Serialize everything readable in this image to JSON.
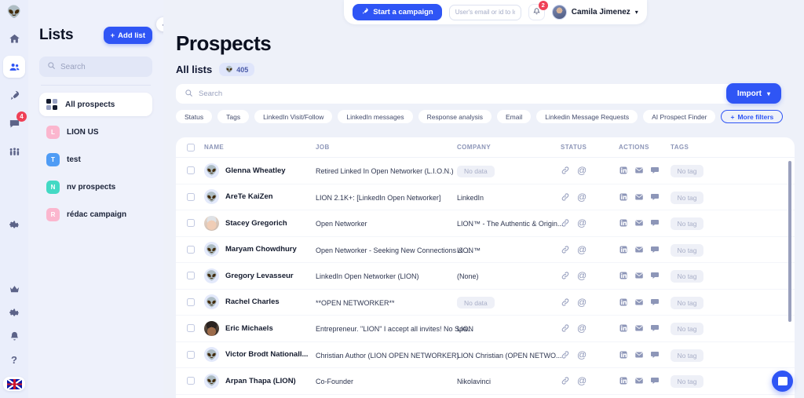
{
  "brand": {
    "logo_icon": "alien-logo",
    "accent": "#2f55f5",
    "danger": "#ef4056"
  },
  "rail": {
    "items": [
      {
        "name": "home",
        "icon": "home-icon",
        "badge": ""
      },
      {
        "name": "prospects",
        "icon": "people-icon",
        "badge": "",
        "active": true
      },
      {
        "name": "campaigns",
        "icon": "rocket-icon",
        "badge": ""
      },
      {
        "name": "inbox",
        "icon": "chat-icon",
        "badge": "4"
      },
      {
        "name": "teams",
        "icon": "group-icon",
        "badge": ""
      },
      {
        "name": "settings",
        "icon": "gear-icon",
        "badge": ""
      }
    ],
    "bottom": [
      {
        "name": "upgrade",
        "icon": "crown-icon"
      },
      {
        "name": "preferences",
        "icon": "gear-icon"
      },
      {
        "name": "notifications",
        "icon": "bell-icon"
      },
      {
        "name": "help",
        "icon": "question-icon"
      },
      {
        "name": "language",
        "icon": "uk-flag-icon"
      }
    ]
  },
  "sidebar": {
    "title": "Lists",
    "add_list_label": "Add list",
    "add_icon": "plus-icon",
    "search": {
      "placeholder": "Search",
      "value": "",
      "icon": "search-icon"
    },
    "all_prospects": {
      "label": "All prospects",
      "icon": "grid-icon"
    },
    "lists": [
      {
        "initial": "L",
        "label": "LION US",
        "color": "#fbb6ce"
      },
      {
        "initial": "T",
        "label": "test",
        "color": "#4f9cf5"
      },
      {
        "initial": "N",
        "label": "nv prospects",
        "color": "#43d9c4"
      },
      {
        "initial": "R",
        "label": "rédac campaign",
        "color": "#fbb6ce"
      }
    ],
    "collapse_icon": "chevron-left-icon"
  },
  "topbar": {
    "campaign_button": {
      "label": "Start a campaign",
      "icon": "rocket-icon"
    },
    "login_input": {
      "placeholder": "User's email or id to login",
      "value": ""
    },
    "bell": {
      "icon": "bell-icon",
      "badge": "2"
    },
    "user": {
      "name": "Camila Jimenez",
      "chevron": "chevron-down-icon",
      "avatar": "user-avatar"
    }
  },
  "page": {
    "title": "Prospects",
    "subtitle": "All lists",
    "count_badge": {
      "icon": "alien-icon",
      "value": "405"
    },
    "search": {
      "placeholder": "Search",
      "value": "",
      "icon": "search-icon"
    },
    "import_button": {
      "label": "Import",
      "chevron": "chevron-down-icon"
    },
    "filters": [
      "Status",
      "Tags",
      "LinkedIn Visit/Follow",
      "LinkedIn messages",
      "Response analysis",
      "Email",
      "Linkedin Message Requests",
      "AI Prospect Finder"
    ],
    "more_filters": {
      "label": "More filters",
      "icon": "plus-icon"
    }
  },
  "table": {
    "columns": [
      "NAME",
      "JOB",
      "COMPANY",
      "STATUS",
      "ACTIONS",
      "TAGS"
    ],
    "select_all_checkbox": false,
    "status_icons": [
      "link-icon",
      "at-icon"
    ],
    "action_icons": [
      "linkedin-icon",
      "envelope-icon",
      "comment-icon"
    ],
    "tag_placeholder": "No tag",
    "no_data_label": "No data",
    "rows": [
      {
        "checked": false,
        "avatar": "alien-avatar",
        "name": "Glenna Wheatley",
        "job": "Retired Linked In Open Networker (L.I.O.N.)",
        "company": "No data",
        "company_empty": true,
        "tag": "No tag"
      },
      {
        "checked": false,
        "avatar": "alien-avatar",
        "name": "AreTe KaiZen",
        "job": "LION 2.1K+: [LinkedIn Open Networker]",
        "company": "LinkedIn",
        "company_empty": false,
        "tag": "No tag"
      },
      {
        "checked": false,
        "avatar": "photo-a",
        "name": "Stacey Gregorich",
        "job": "Open Networker",
        "company": "LION™ - The Authentic & Origin...",
        "company_empty": false,
        "tag": "No tag"
      },
      {
        "checked": false,
        "avatar": "alien-avatar",
        "name": "Maryam Chowdhury",
        "job": "Open Networker - Seeking New Connections & ...",
        "company": "LION™",
        "company_empty": false,
        "tag": "No tag"
      },
      {
        "checked": false,
        "avatar": "alien-avatar",
        "name": "Gregory Levasseur",
        "job": "LinkedIn Open Networker (LION)",
        "company": "(None)",
        "company_empty": false,
        "tag": "No tag"
      },
      {
        "checked": false,
        "avatar": "alien-avatar",
        "name": "Rachel Charles",
        "job": "**OPEN NETWORKER**",
        "company": "No data",
        "company_empty": true,
        "tag": "No tag"
      },
      {
        "checked": false,
        "avatar": "photo-b",
        "name": "Eric Michaels",
        "job": "Entrepreneur. \"LION\" I accept all invites! No Spa...",
        "company": "LION",
        "company_empty": false,
        "tag": "No tag"
      },
      {
        "checked": false,
        "avatar": "alien-avatar",
        "name": "Victor Brodt Nationall...",
        "job": "Christian Author (LION OPEN NETWORKER) .",
        "company": "LION Christian (OPEN NETWO...",
        "company_empty": false,
        "tag": "No tag"
      },
      {
        "checked": false,
        "avatar": "alien-avatar",
        "name": "Arpan Thapa (LION)",
        "job": "Co-Founder",
        "company": "Nikolavinci",
        "company_empty": false,
        "tag": "No tag"
      }
    ]
  },
  "chat_widget": {
    "icon": "chat-bubble-icon"
  }
}
